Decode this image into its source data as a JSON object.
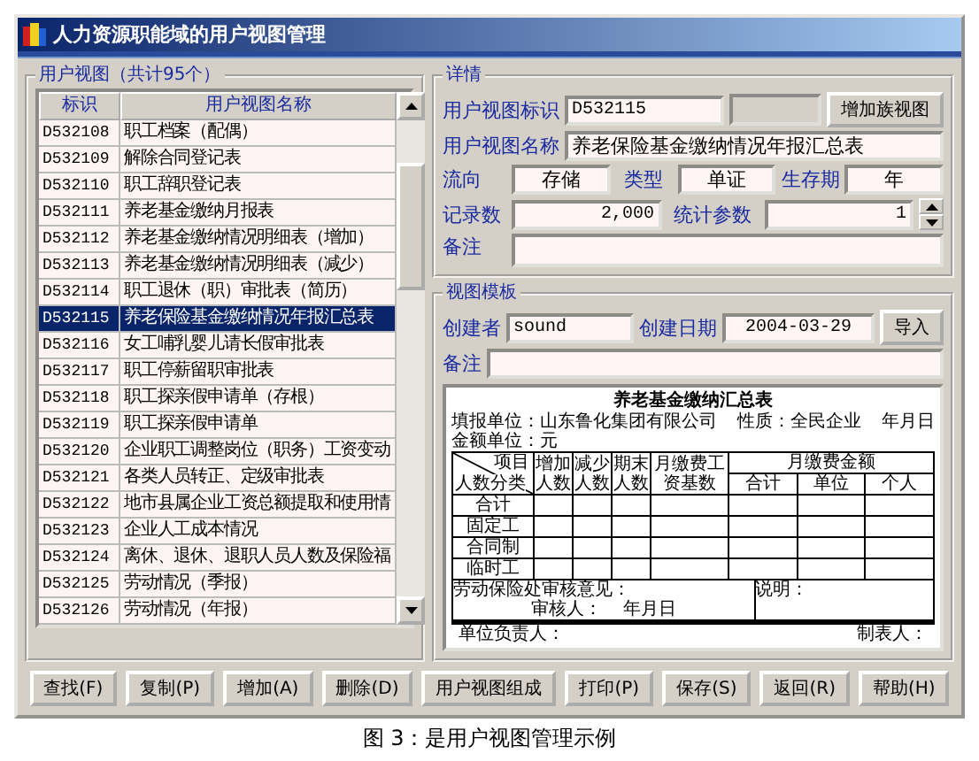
{
  "window": {
    "title": "人力资源职能域的用户视图管理"
  },
  "view_list": {
    "title": "用户视图（共计95个）",
    "columns": [
      "标识",
      "用户视图名称"
    ],
    "rows": [
      {
        "id": "D532108",
        "name": "职工档案（配偶）",
        "selected": false
      },
      {
        "id": "D532109",
        "name": "解除合同登记表",
        "selected": false
      },
      {
        "id": "D532110",
        "name": "职工辞职登记表",
        "selected": false
      },
      {
        "id": "D532111",
        "name": "养老基金缴纳月报表",
        "selected": false
      },
      {
        "id": "D532112",
        "name": "养老基金缴纳情况明细表（增加）",
        "selected": false
      },
      {
        "id": "D532113",
        "name": "养老基金缴纳情况明细表（减少）",
        "selected": false
      },
      {
        "id": "D532114",
        "name": "职工退休（职）审批表（简历）",
        "selected": false
      },
      {
        "id": "D532115",
        "name": "养老保险基金缴纳情况年报汇总表",
        "selected": true
      },
      {
        "id": "D532116",
        "name": "女工哺乳婴儿请长假审批表",
        "selected": false
      },
      {
        "id": "D532117",
        "name": "职工停薪留职审批表",
        "selected": false
      },
      {
        "id": "D532118",
        "name": "职工探亲假申请单（存根）",
        "selected": false
      },
      {
        "id": "D532119",
        "name": "职工探亲假申请单",
        "selected": false
      },
      {
        "id": "D532120",
        "name": "企业职工调整岗位（职务）工资变动",
        "selected": false
      },
      {
        "id": "D532121",
        "name": "各类人员转正、定级审批表",
        "selected": false
      },
      {
        "id": "D532122",
        "name": "地市县属企业工资总额提取和使用情",
        "selected": false
      },
      {
        "id": "D532123",
        "name": "企业人工成本情况",
        "selected": false
      },
      {
        "id": "D532124",
        "name": "离休、退休、退职人员人数及保险福",
        "selected": false
      },
      {
        "id": "D532125",
        "name": "劳动情况（季报）",
        "selected": false
      },
      {
        "id": "D532126",
        "name": "劳动情况（年报）",
        "selected": false
      }
    ]
  },
  "details": {
    "title": "详情",
    "id_label": "用户视图标识",
    "id_value": "D532115",
    "add_button": "增加族视图",
    "name_label": "用户视图名称",
    "name_value": "养老保险基金缴纳情况年报汇总表",
    "flow_label": "流向",
    "flow_value": "存储",
    "type_label": "类型",
    "type_value": "单证",
    "life_label": "生存期",
    "life_value": "年",
    "records_label": "记录数",
    "records_value": "2,000",
    "stats_label": "统计参数",
    "stats_value": "1",
    "remark_label": "备注"
  },
  "template": {
    "title": "视图模板",
    "creator_label": "创建者",
    "creator_value": "sound",
    "date_label": "创建日期",
    "date_value": "2004-03-29",
    "import_button": "导入",
    "remark_label": "备注",
    "preview": {
      "title": "养老基金缴纳汇总表",
      "info": [
        "填报单位：山东鲁化集团有限公司",
        "性质：全民企业",
        "年月日",
        "金额单位：元"
      ],
      "corner_top": "项目",
      "corner_bottom": "人数分类",
      "headers": [
        "增加人数",
        "减少人数",
        "期末人数",
        "月缴费工资基数"
      ],
      "group_header": "月缴费金额",
      "sub_headers": [
        "合计",
        "单位",
        "个人"
      ],
      "row_labels": [
        "合计",
        "固定工",
        "合同制",
        "临时工"
      ],
      "opinion": "劳动保险处审核意见：",
      "reviewer": "审核人：",
      "date": "年月日",
      "note": "说明：",
      "footer": [
        "单位负责人：",
        "制表人："
      ]
    }
  },
  "buttons": [
    "查找(F)",
    "复制(P)",
    "增加(A)",
    "删除(D)",
    "用户视图组成",
    "打印(P)",
    "保存(S)",
    "返回(R)",
    "帮助(H)"
  ],
  "caption": "图 3：是用户视图管理示例"
}
